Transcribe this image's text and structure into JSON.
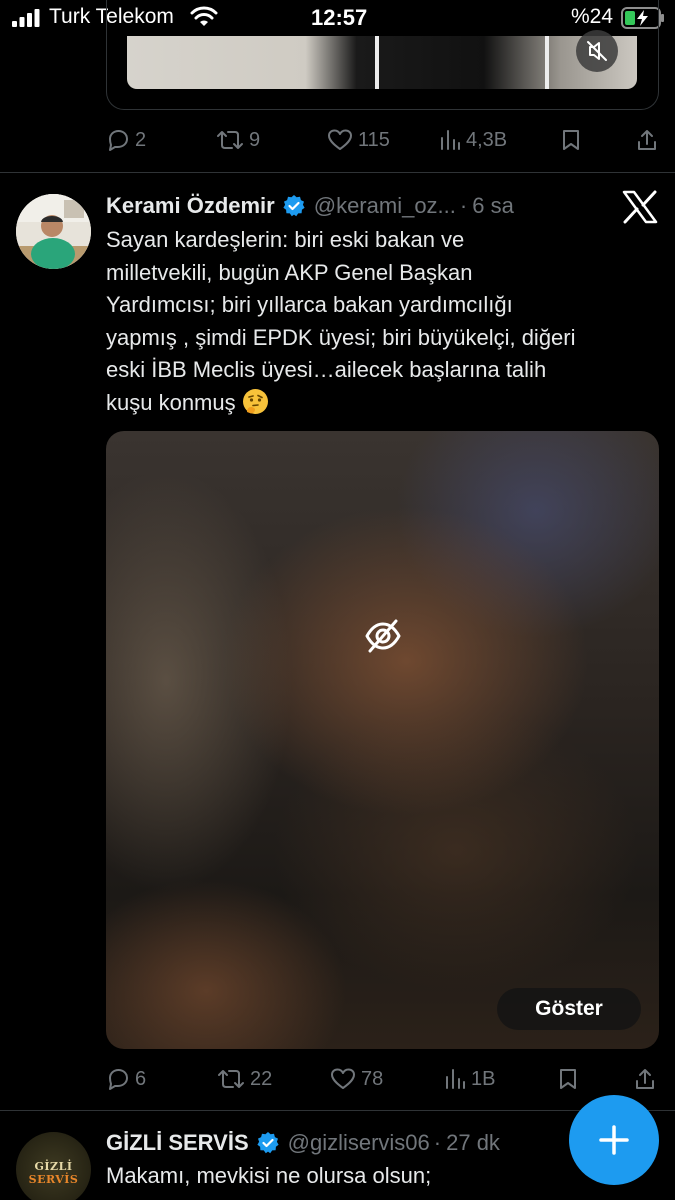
{
  "status_bar": {
    "carrier": "Turk Telekom",
    "time": "12:57",
    "battery": "%24",
    "icons": [
      "signal-icon",
      "wifi-icon",
      "battery-charging-icon"
    ]
  },
  "previous_tweet": {
    "replies": "2",
    "retweets": "9",
    "likes": "115",
    "views": "4,3B"
  },
  "tweet": {
    "display_name": "Kerami Özdemir",
    "handle": "@kerami_oz...",
    "dot": "·",
    "time_ago": "6 sa",
    "text": "Sayan kardeşlerin:  biri eski bakan ve\nmilletvekili, bugün AKP Genel Başkan\nYardımcısı; biri yıllarca bakan yardımcılığı\nyapmış , şimdi EPDK üyesi; biri büyükelçi, diğeri\neski İBB Meclis üyesi…ailecek başlarına talih\nkuşu konmuş",
    "emoji": "thinking-face-emoji",
    "show_label": "Göster",
    "replies": "6",
    "retweets": "22",
    "likes": "78",
    "views": "1B",
    "colors": {
      "verified": "#1d9bf0",
      "muted_text": "#71767b"
    }
  },
  "next_tweet": {
    "avatar_text_a": "GİZLİ ",
    "avatar_text_b": "SERVİS",
    "display_name": "GİZLİ SERVİS",
    "handle": "@gizliservis06",
    "dot": "·",
    "time_ago": "27 dk",
    "text": "Makamı, mevkisi ne olursa olsun;"
  },
  "fab": {
    "icon": "plus-icon",
    "color": "#1d9bf0"
  }
}
